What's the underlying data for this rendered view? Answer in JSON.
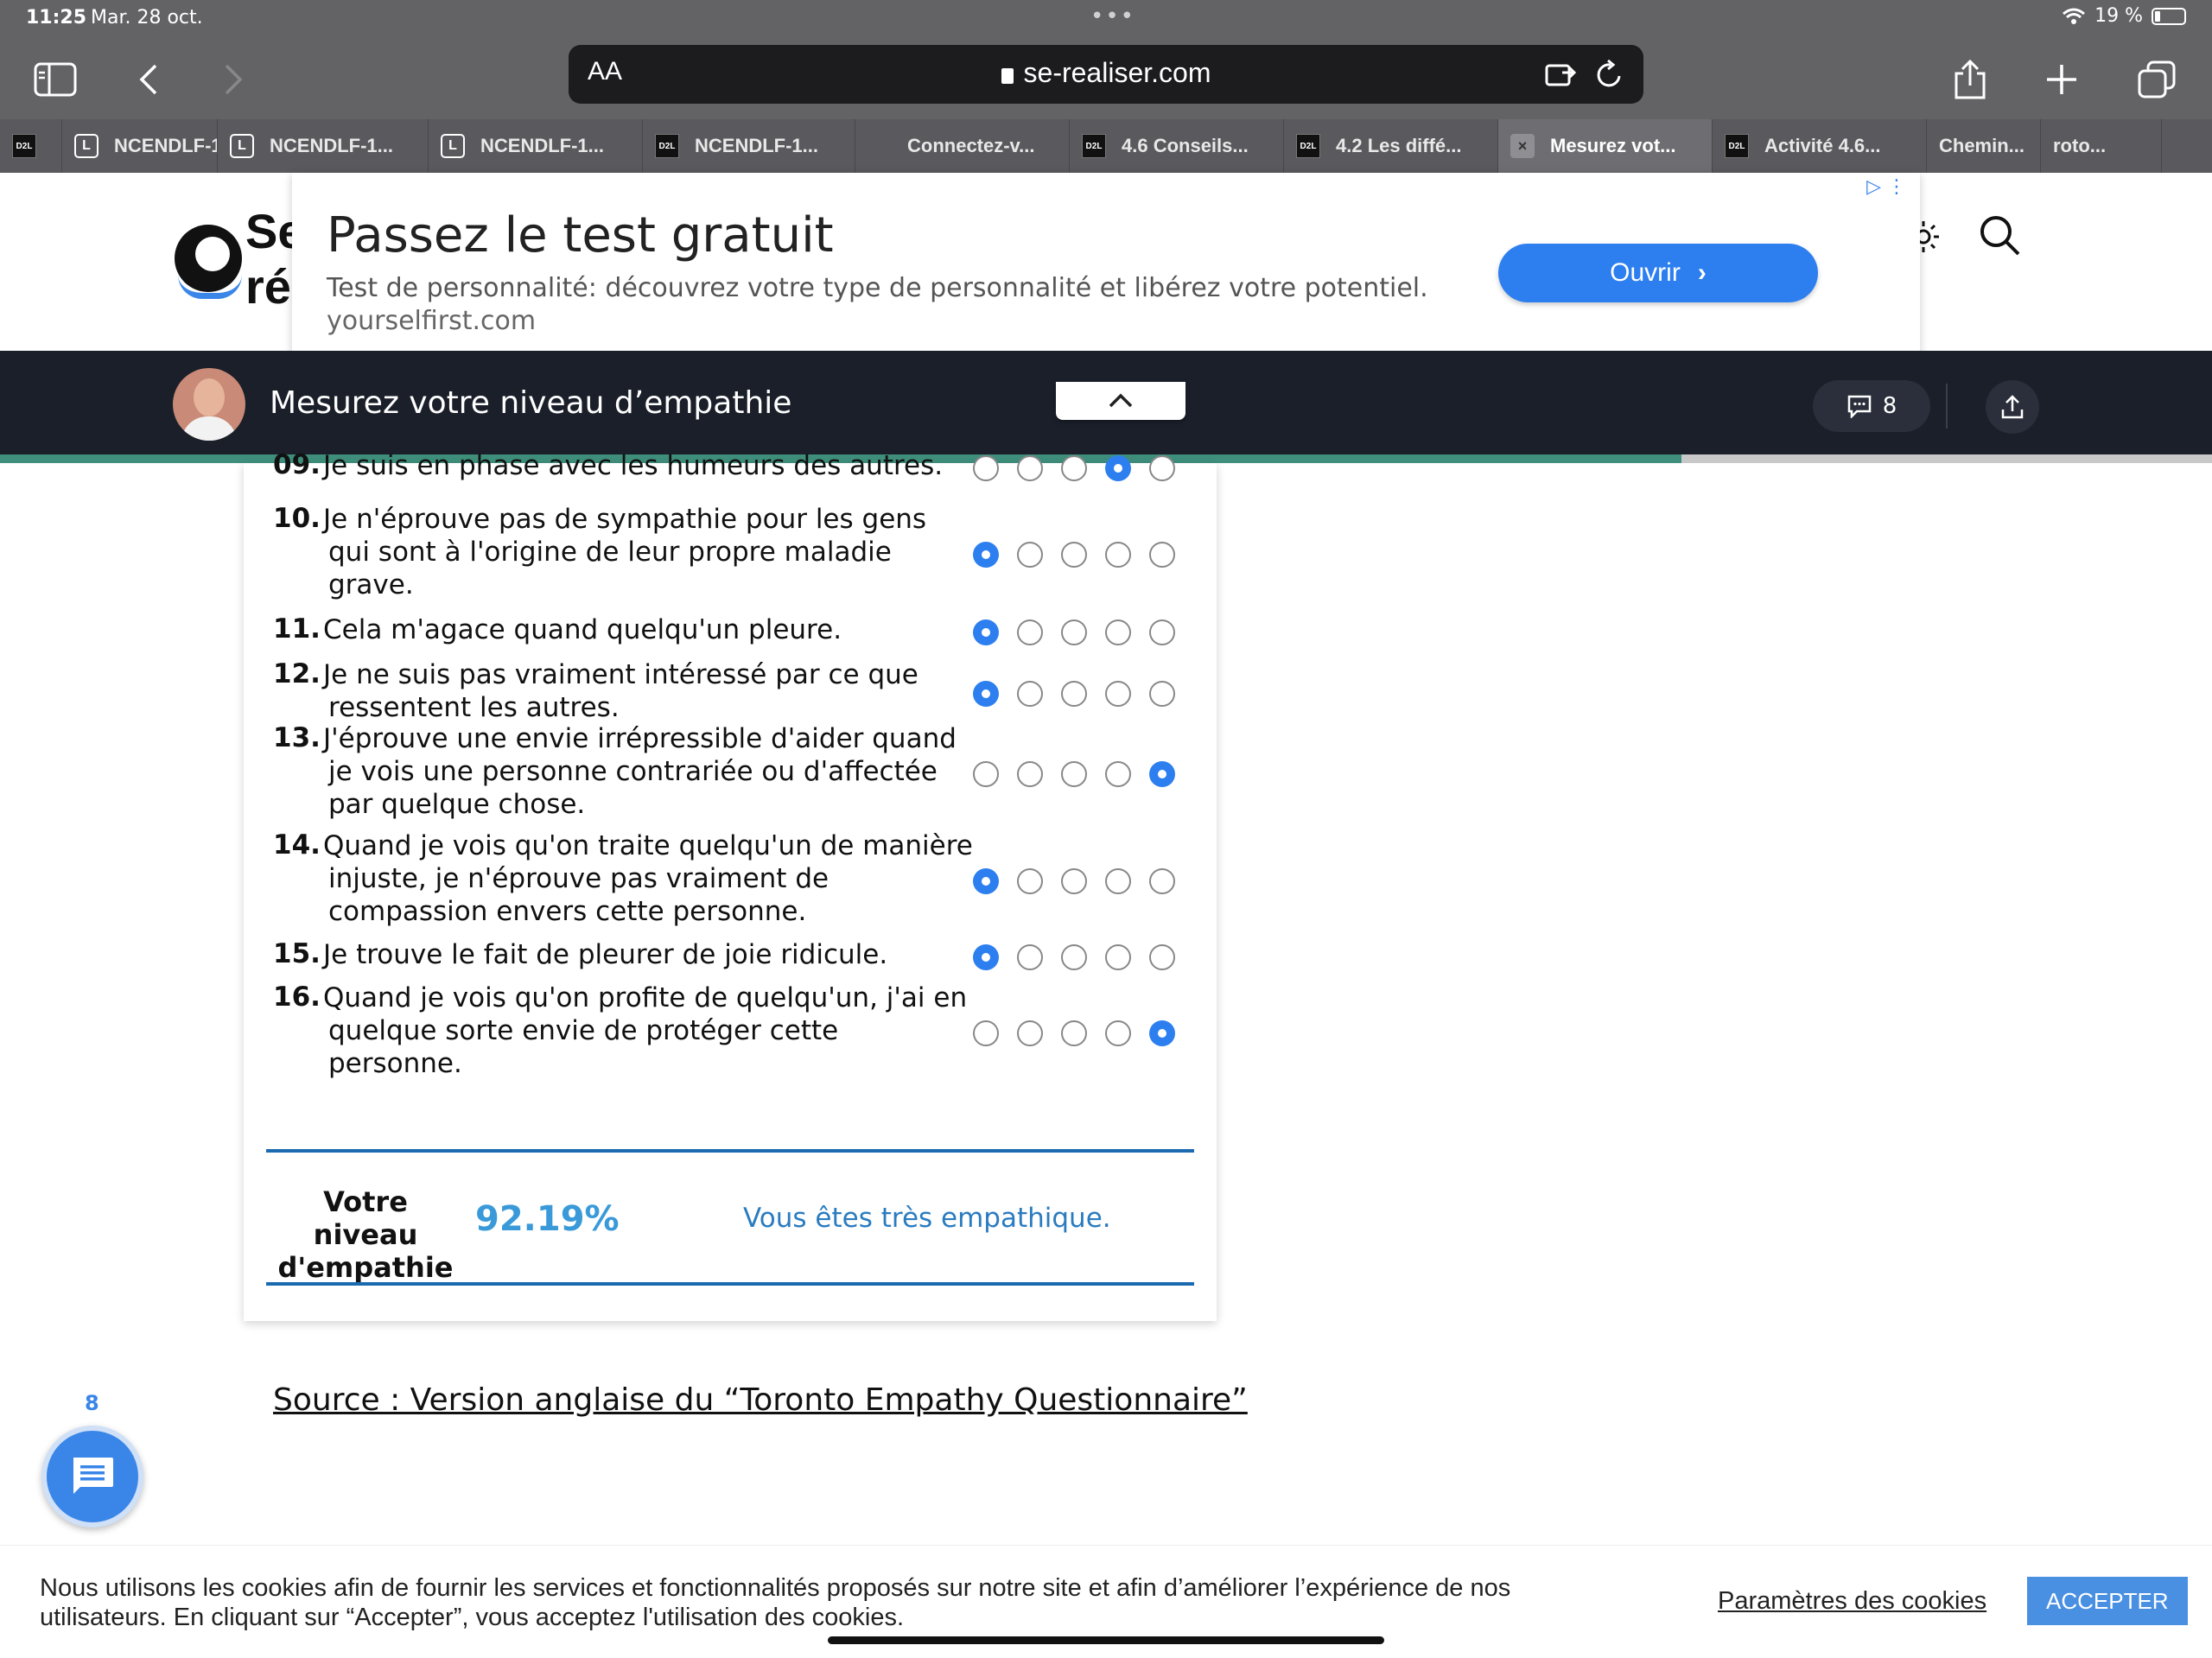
{
  "status_bar": {
    "time": "11:25",
    "date": "Mar. 28 oct.",
    "battery": "19 %"
  },
  "browser": {
    "aa_label": "AA",
    "url": "se-realiser.com"
  },
  "tabs": [
    {
      "label": "",
      "favicon": "d2l",
      "active": false
    },
    {
      "label": "NCENDLF-1",
      "favicon": "l",
      "active": false
    },
    {
      "label": "NCENDLF-1...",
      "favicon": "l",
      "active": false
    },
    {
      "label": "NCENDLF-1...",
      "favicon": "l",
      "active": false
    },
    {
      "label": "NCENDLF-1...",
      "favicon": "d2l",
      "active": false
    },
    {
      "label": "Connectez-v...",
      "favicon": "ms",
      "active": false
    },
    {
      "label": "4.6 Conseils...",
      "favicon": "d2l",
      "active": false
    },
    {
      "label": "4.2 Les diffé...",
      "favicon": "d2l",
      "active": false
    },
    {
      "label": "Mesurez vot...",
      "favicon": "x",
      "active": true
    },
    {
      "label": "Activité 4.6...",
      "favicon": "d2l",
      "active": false
    },
    {
      "label": "Chemin...",
      "favicon": "none",
      "active": false
    },
    {
      "label": "roto...",
      "favicon": "none",
      "active": false
    }
  ],
  "site": {
    "logo_line1": "Se",
    "logo_line2": "ré"
  },
  "ad": {
    "title": "Passez le test gratuit",
    "description": "Test de personnalité: découvrez votre type de personnalité et libérez votre potentiel.",
    "domain": "yourselfirst.com",
    "button_label": "Ouvrir"
  },
  "article": {
    "title": "Mesurez votre niveau d’empathie",
    "comment_count": "8",
    "progress": 0.76
  },
  "quiz": {
    "questions": [
      {
        "num": "09.",
        "lines": [
          "Je suis en phase avec les humeurs des autres."
        ],
        "selected": 3
      },
      {
        "num": "10.",
        "lines": [
          "Je n'éprouve pas de sympathie pour les gens",
          "qui sont à l'origine de leur propre maladie",
          "grave."
        ],
        "selected": 0
      },
      {
        "num": "11.",
        "lines": [
          "Cela m'agace quand quelqu'un pleure."
        ],
        "selected": 0
      },
      {
        "num": "12.",
        "lines": [
          "Je ne suis pas vraiment intéressé par ce que",
          "ressentent les autres."
        ],
        "selected": 0
      },
      {
        "num": "13.",
        "lines": [
          "J'éprouve une envie irrépressible d'aider quand",
          "je vois une personne contrariée ou d'affectée",
          "par quelque chose."
        ],
        "selected": 4
      },
      {
        "num": "14.",
        "lines": [
          "Quand je vois qu'on traite quelqu'un de manière",
          "injuste, je n'éprouve pas vraiment de",
          "compassion envers cette personne."
        ],
        "selected": 0
      },
      {
        "num": "15.",
        "lines": [
          "Je trouve le fait de pleurer de joie ridicule."
        ],
        "selected": 0
      },
      {
        "num": "16.",
        "lines": [
          "Quand je vois qu'on profite de quelqu'un, j'ai en",
          "quelque sorte envie de protéger cette",
          "personne."
        ],
        "selected": 4
      }
    ],
    "result": {
      "label_line1": "Votre niveau",
      "label_line2": "d'empathie",
      "score": "92.19%",
      "message": "Vous êtes très empathique."
    }
  },
  "source_text": "Source : Version anglaise du “Toronto Empathy Questionnaire”",
  "floating": {
    "comment_count": "8"
  },
  "cookie": {
    "text": "Nous utilisons les cookies afin de fournir les services et fonctionnalités proposés sur notre site et afin d’améliorer l’expérience de nos utilisateurs. En cliquant sur “Accepter”, vous acceptez l'utilisation des cookies.",
    "settings_label": "Paramètres des cookies",
    "accept_label": "ACCEPTER"
  },
  "colors": {
    "accent": "#2d7ff0",
    "progress": "#3f8f7c",
    "result_line": "#1b6ab0",
    "score": "#3a9ad9"
  }
}
